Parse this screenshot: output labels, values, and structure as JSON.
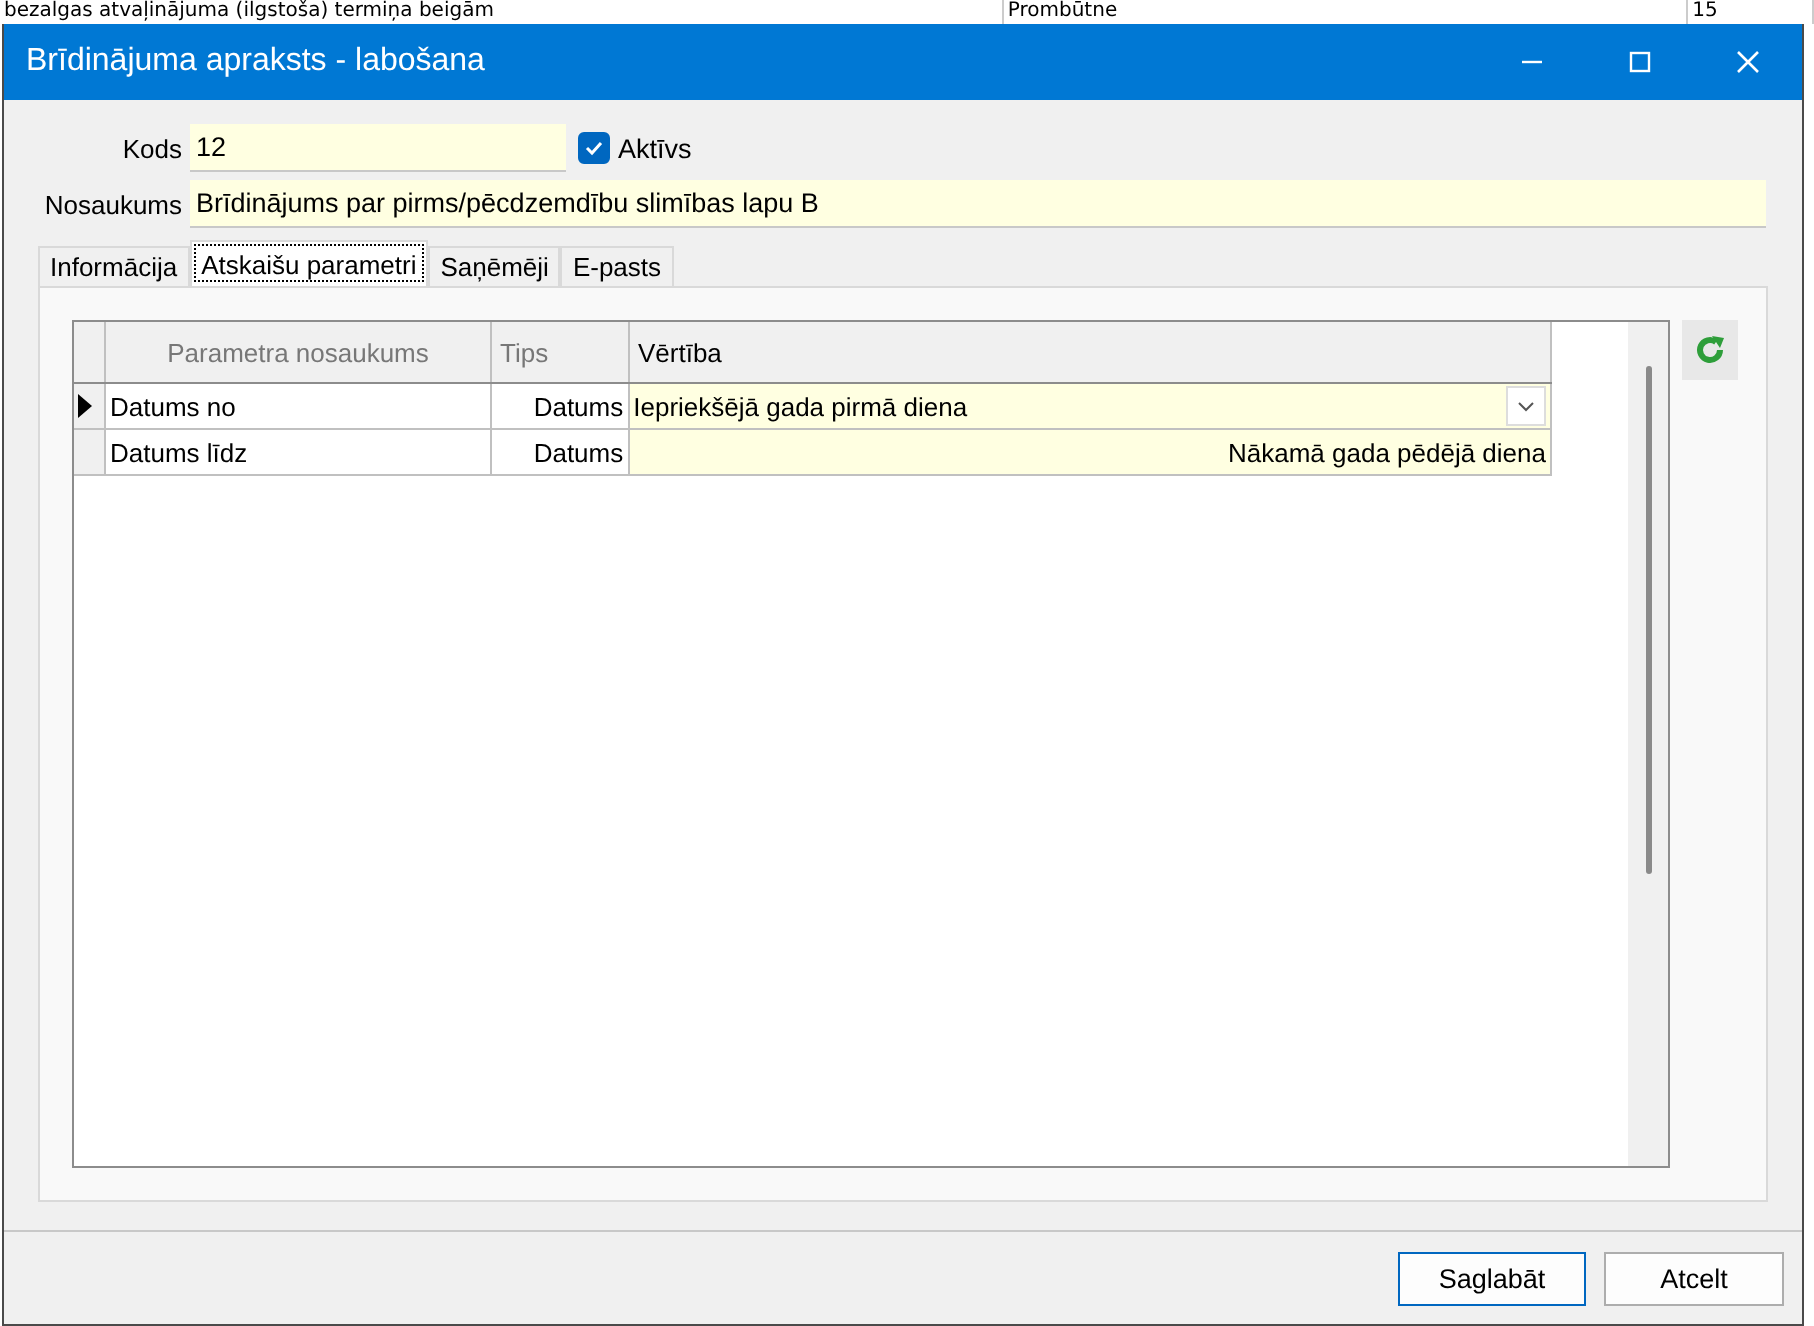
{
  "background_row": {
    "cells": [
      "bezalgas atvaļinājuma (ilgstoša) termiņa beigām",
      "Prombūtne",
      "15"
    ]
  },
  "window": {
    "title": "Brīdinājuma apraksts - labošana"
  },
  "form": {
    "code": {
      "label": "Kods",
      "value": "12"
    },
    "active": {
      "label": "Aktīvs",
      "checked": true
    },
    "name": {
      "label": "Nosaukums",
      "value": "Brīdinājums par pirms/pēcdzemdību slimības lapu B"
    }
  },
  "tabs": [
    {
      "label": "Informācija",
      "selected": false
    },
    {
      "label": "Atskaišu parametri",
      "selected": true
    },
    {
      "label": "Saņēmēji",
      "selected": false
    },
    {
      "label": "E-pasts",
      "selected": false
    }
  ],
  "table": {
    "columns": [
      "Parametra nosaukums",
      "Tips",
      "Vērtība"
    ],
    "rows": [
      {
        "name": "Datums no",
        "type": "Datums",
        "value": "Iepriekšējā gada pirmā diena",
        "selected": true
      },
      {
        "name": "Datums līdz",
        "type": "Datums",
        "value": "Nākamā gada pēdējā diena",
        "selected": false
      }
    ]
  },
  "buttons": [
    "Saglabāt",
    "Atcelt"
  ]
}
